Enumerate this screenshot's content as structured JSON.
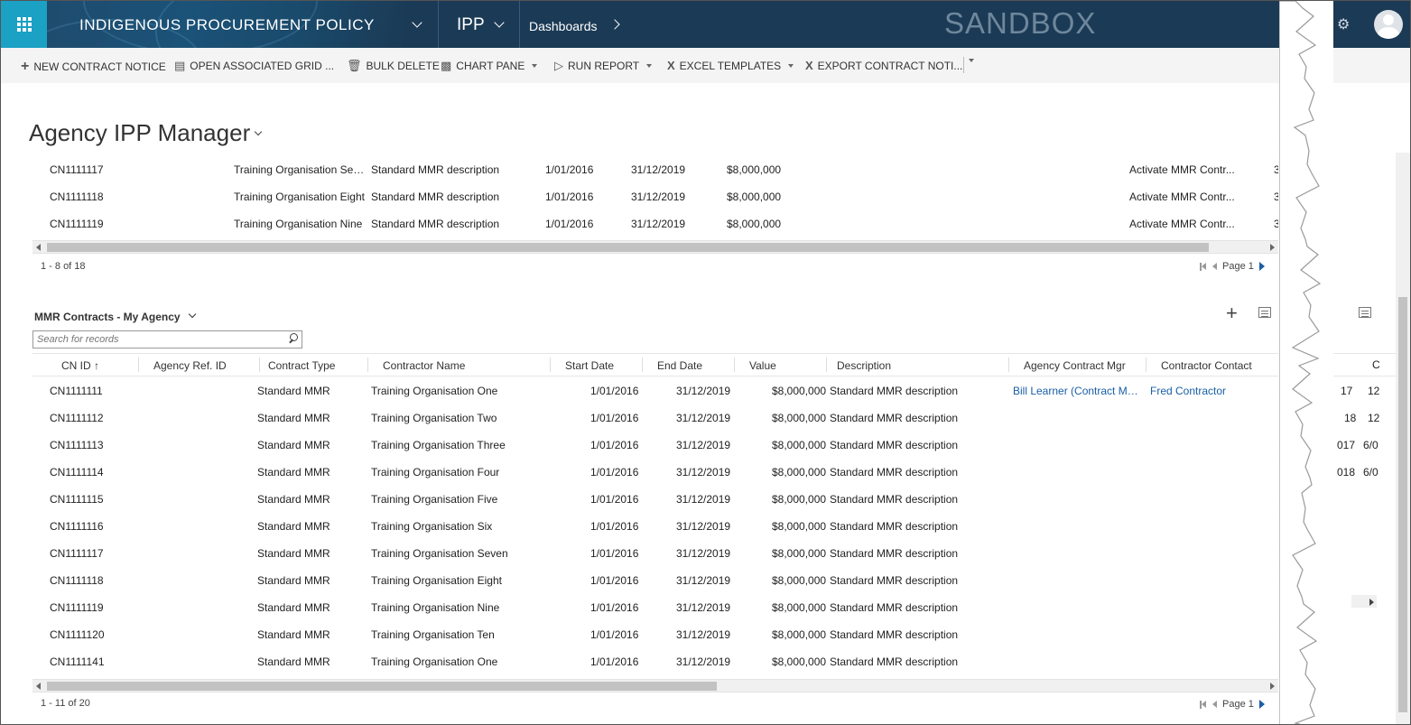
{
  "nav": {
    "app_title": "INDIGENOUS PROCUREMENT POLICY",
    "area": "IPP",
    "section": "Dashboards",
    "environment": "SANDBOX"
  },
  "commands": [
    {
      "label": "NEW CONTRACT NOTICE",
      "icon": "plus-icon"
    },
    {
      "label": "OPEN ASSOCIATED GRID ...",
      "icon": "grid-view-icon"
    },
    {
      "label": "BULK DELETE",
      "icon": "bulk-delete-icon"
    },
    {
      "label": "CHART PANE",
      "icon": "chart-pane-icon"
    },
    {
      "label": "RUN REPORT",
      "icon": "run-report-icon"
    },
    {
      "label": "EXCEL TEMPLATES",
      "icon": "excel-icon"
    },
    {
      "label": "EXPORT CONTRACT NOTI...",
      "icon": "export-excel-icon"
    }
  ],
  "page": {
    "title": "Agency IPP Manager"
  },
  "grid1": {
    "rows": [
      {
        "id": "CN1111117",
        "name": "Training Organisation Sev...",
        "desc": "Standard MMR description",
        "start": "1/01/2016",
        "end": "31/12/2019",
        "value": "$8,000,000",
        "action": "Activate MMR Contr...",
        "extra": "3"
      },
      {
        "id": "CN1111118",
        "name": "Training Organisation Eight",
        "desc": "Standard MMR description",
        "start": "1/01/2016",
        "end": "31/12/2019",
        "value": "$8,000,000",
        "action": "Activate MMR Contr...",
        "extra": "3"
      },
      {
        "id": "CN1111119",
        "name": "Training Organisation Nine",
        "desc": "Standard MMR description",
        "start": "1/01/2016",
        "end": "31/12/2019",
        "value": "$8,000,000",
        "action": "Activate MMR Contr...",
        "extra": "3"
      }
    ],
    "count": "1 - 8 of 18",
    "page_label": "Page 1"
  },
  "grid2": {
    "view_title": "MMR Contracts - My Agency",
    "search_placeholder": "Search for records",
    "columns": [
      "CN ID ↑",
      "Agency Ref. ID",
      "Contract Type",
      "Contractor Name",
      "Start Date",
      "End Date",
      "Value",
      "Description",
      "Agency Contract Mgr",
      "Contractor Contact"
    ],
    "rows": [
      {
        "id": "CN1111111",
        "type": "Standard MMR",
        "name": "Training Organisation One",
        "start": "1/01/2016",
        "end": "31/12/2019",
        "value": "$8,000,000",
        "desc": "Standard MMR description",
        "mgr": "Bill Learner (Contract Ma...",
        "contact": "Fred Contractor"
      },
      {
        "id": "CN1111112",
        "type": "Standard MMR",
        "name": "Training Organisation Two",
        "start": "1/01/2016",
        "end": "31/12/2019",
        "value": "$8,000,000",
        "desc": "Standard MMR description",
        "mgr": "",
        "contact": ""
      },
      {
        "id": "CN1111113",
        "type": "Standard MMR",
        "name": "Training Organisation Three",
        "start": "1/01/2016",
        "end": "31/12/2019",
        "value": "$8,000,000",
        "desc": "Standard MMR description",
        "mgr": "",
        "contact": ""
      },
      {
        "id": "CN1111114",
        "type": "Standard MMR",
        "name": "Training Organisation Four",
        "start": "1/01/2016",
        "end": "31/12/2019",
        "value": "$8,000,000",
        "desc": "Standard MMR description",
        "mgr": "",
        "contact": ""
      },
      {
        "id": "CN1111115",
        "type": "Standard MMR",
        "name": "Training Organisation Five",
        "start": "1/01/2016",
        "end": "31/12/2019",
        "value": "$8,000,000",
        "desc": "Standard MMR description",
        "mgr": "",
        "contact": ""
      },
      {
        "id": "CN1111116",
        "type": "Standard MMR",
        "name": "Training Organisation Six",
        "start": "1/01/2016",
        "end": "31/12/2019",
        "value": "$8,000,000",
        "desc": "Standard MMR description",
        "mgr": "",
        "contact": ""
      },
      {
        "id": "CN1111117",
        "type": "Standard MMR",
        "name": "Training Organisation Seven",
        "start": "1/01/2016",
        "end": "31/12/2019",
        "value": "$8,000,000",
        "desc": "Standard MMR description",
        "mgr": "",
        "contact": ""
      },
      {
        "id": "CN1111118",
        "type": "Standard MMR",
        "name": "Training Organisation Eight",
        "start": "1/01/2016",
        "end": "31/12/2019",
        "value": "$8,000,000",
        "desc": "Standard MMR description",
        "mgr": "",
        "contact": ""
      },
      {
        "id": "CN1111119",
        "type": "Standard MMR",
        "name": "Training Organisation Nine",
        "start": "1/01/2016",
        "end": "31/12/2019",
        "value": "$8,000,000",
        "desc": "Standard MMR description",
        "mgr": "",
        "contact": ""
      },
      {
        "id": "CN1111120",
        "type": "Standard MMR",
        "name": "Training Organisation Ten",
        "start": "1/01/2016",
        "end": "31/12/2019",
        "value": "$8,000,000",
        "desc": "Standard MMR description",
        "mgr": "",
        "contact": ""
      },
      {
        "id": "CN1111141",
        "type": "Standard MMR",
        "name": "Training Organisation One",
        "start": "1/01/2016",
        "end": "31/12/2019",
        "value": "$8,000,000",
        "desc": "Standard MMR description",
        "mgr": "",
        "contact": ""
      }
    ],
    "count": "1 - 11 of 20",
    "page_label": "Page 1"
  },
  "peek": {
    "header": [
      "C"
    ],
    "rows": [
      [
        "17",
        "12"
      ],
      [
        "18",
        "12"
      ],
      [
        "017",
        "6/0"
      ],
      [
        "018",
        "6/0"
      ]
    ]
  }
}
